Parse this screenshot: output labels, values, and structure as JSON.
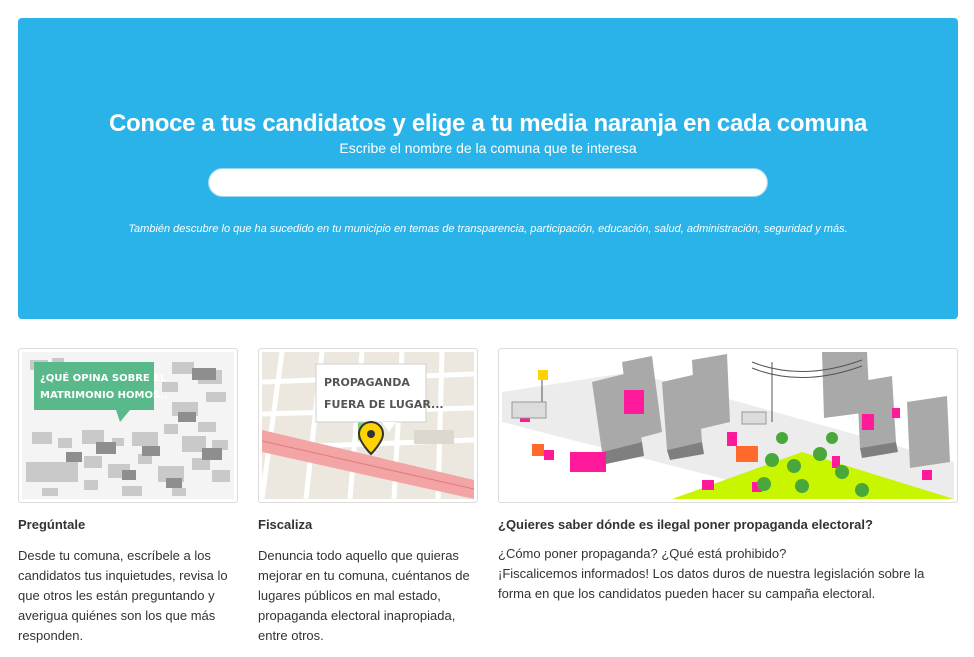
{
  "hero": {
    "title": "Conoce a tus candidatos y elige a tu media naranja en cada comuna",
    "prompt": "Escribe el nombre de la comuna que te interesa",
    "search_value": "",
    "note": "También descubre lo que ha sucedido en tu municipio en temas de transparencia, participación, educación, salud, administración, seguridad y más."
  },
  "cards": [
    {
      "image_text": [
        "¿QUÉ OPINA SOBRE EL",
        "MATRIMONIO HOMOS.."
      ],
      "title": "Pregúntale",
      "text": "Desde tu comuna, escríbele a los candidatos tus inquietudes, revisa lo que otros les están preguntando y averigua quiénes son los que más responden."
    },
    {
      "image_text": [
        "PROPAGANDA",
        "FUERA DE LUGAR..."
      ],
      "title": "Fiscaliza",
      "text": "Denuncia todo aquello que quieras mejorar en tu comuna, cuéntanos de lugares públicos en mal estado, propaganda electoral inapropiada, entre otros."
    },
    {
      "title": "¿Quieres saber dónde es ilegal poner propaganda electoral?",
      "line1": "¿Cómo poner propaganda? ¿Qué está prohibido?",
      "line2": "¡Fiscalicemos informados! Los datos duros de nuestra legislación sobre la forma en que los candidatos pueden hacer su campaña electoral."
    }
  ],
  "colors": {
    "hero_bg": "#29b3e8",
    "accent_green": "#59b98b",
    "accent_pink": "#ff1a9c",
    "accent_lime": "#c8f500"
  }
}
